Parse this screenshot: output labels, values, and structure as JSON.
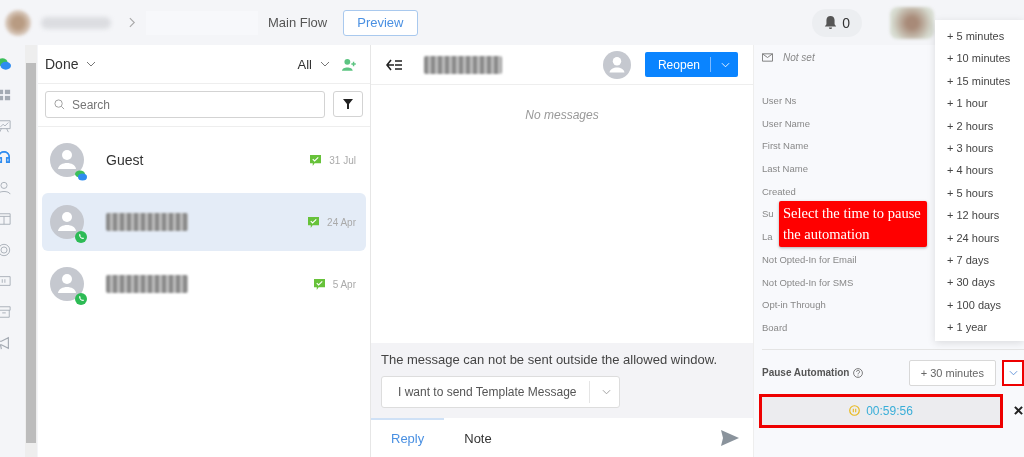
{
  "header": {
    "breadcrumb_current": "Main Flow",
    "preview_button": "Preview",
    "notifications": "0"
  },
  "sidebar": {
    "items": [
      {
        "kind": "chat",
        "selected": false
      },
      {
        "kind": "grid",
        "selected": false
      },
      {
        "kind": "chart",
        "selected": false
      },
      {
        "kind": "headset",
        "selected": true
      },
      {
        "kind": "user",
        "selected": false
      },
      {
        "kind": "columns",
        "selected": false
      },
      {
        "kind": "ring",
        "selected": false
      },
      {
        "kind": "card",
        "selected": false
      },
      {
        "kind": "archive",
        "selected": false
      },
      {
        "kind": "megaphone",
        "selected": false
      }
    ]
  },
  "conversations": {
    "status_filter": "Done",
    "assignee_filter": "All",
    "search": {
      "placeholder": "Search"
    },
    "items": [
      {
        "name": "Guest",
        "kind": "webchat",
        "date": "31 Jul",
        "selected": false
      },
      {
        "kind": "whatsapp",
        "date": "24 Apr",
        "selected": true
      },
      {
        "kind": "whatsapp",
        "date": "5 Apr",
        "selected": false
      }
    ]
  },
  "chat": {
    "reopen_button": "Reopen",
    "empty_text": "No messages",
    "notice": "The message can not be sent outside the allowed window.",
    "template_select": "I want to send Template Message",
    "tabs": [
      {
        "label": "Reply",
        "selected": true
      },
      {
        "label": "Note",
        "selected": false
      }
    ]
  },
  "details": {
    "email": "Not set",
    "fields": [
      "User Ns",
      "User Name",
      "First Name",
      "Last Name",
      "Created",
      "Su",
      "La",
      "Not Opted-In for Email",
      "Not Opted-In for SMS",
      "Opt-in Through",
      "Board"
    ],
    "pause_label": "Pause Automation",
    "pause_value": "+ 30 minutes",
    "timer": "00:59:56",
    "menu": [
      "+ 5 minutes",
      "+ 10 minutes",
      "+ 15 minutes",
      "+ 1 hour",
      "+ 2 hours",
      "+ 3 hours",
      "+ 4 hours",
      "+ 5 hours",
      "+ 12 hours",
      "+ 24 hours",
      "+ 7 days",
      "+ 30 days",
      "+ 100 days",
      "+ 1 year"
    ]
  },
  "callout": {
    "text": "Select the time to pause the automation"
  }
}
